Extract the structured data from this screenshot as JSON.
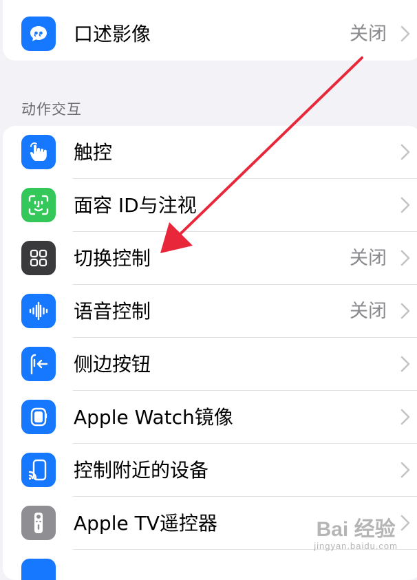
{
  "top_group": {
    "item": {
      "label": "口述影像",
      "value": "关闭",
      "icon": "speech-bubble-quote-icon",
      "icon_color": "#1677ff"
    }
  },
  "section": {
    "header": "动作交互",
    "items": [
      {
        "label": "触控",
        "value": "",
        "icon": "hand-tap-icon",
        "icon_color": "#1677ff"
      },
      {
        "label": "面容 ID与注视",
        "value": "",
        "icon": "face-id-icon",
        "icon_color": "#34c759"
      },
      {
        "label": "切换控制",
        "value": "关闭",
        "icon": "switch-control-grid-icon",
        "icon_color": "#3a3a3c"
      },
      {
        "label": "语音控制",
        "value": "关闭",
        "icon": "voice-waveform-icon",
        "icon_color": "#1677ff"
      },
      {
        "label": "侧边按钮",
        "value": "",
        "icon": "side-button-icon",
        "icon_color": "#1677ff"
      },
      {
        "label": "Apple Watch镜像",
        "value": "",
        "icon": "apple-watch-icon",
        "icon_color": "#1677ff"
      },
      {
        "label": "控制附近的设备",
        "value": "",
        "icon": "nearby-devices-icon",
        "icon_color": "#1677ff"
      },
      {
        "label": "Apple TV遥控器",
        "value": "",
        "icon": "tv-remote-icon",
        "icon_color": "#8e8e93"
      }
    ]
  },
  "annotation": {
    "arrow_color": "#e8283a"
  },
  "watermark": {
    "main": "Bai 经验",
    "sub": "jingyan.baidu.com"
  }
}
